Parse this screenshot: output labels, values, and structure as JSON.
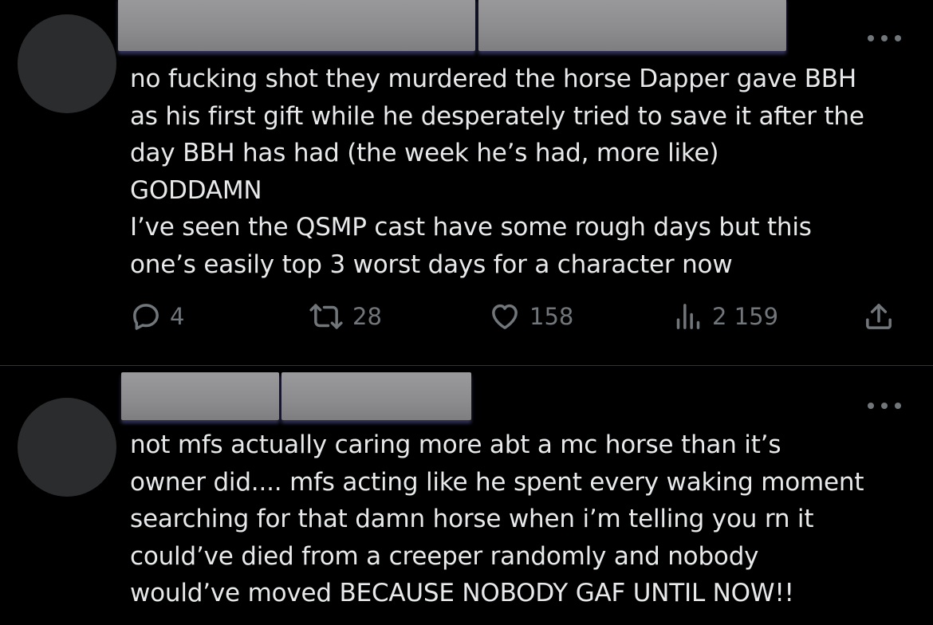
{
  "colors": {
    "background": "#000000",
    "text": "#e7e9ea",
    "muted": "#71767b",
    "divider": "#2f3336",
    "redaction": "#8c8c8e"
  },
  "tweets": [
    {
      "body_lines": [
        "no fucking shot they murdered the horse Dapper gave BBH",
        "as his first gift while he desperately tried to save it after the",
        "day BBH has had (the week he’s had, more like)",
        "GODDAMN",
        "I’ve seen the QSMP cast have some rough days but this",
        "one’s easily top 3 worst days for a character now"
      ],
      "actions": {
        "replies": "4",
        "reposts": "28",
        "likes": "158",
        "views": "2 159"
      },
      "icons": [
        "reply-icon",
        "repost-icon",
        "like-icon",
        "views-icon",
        "share-icon",
        "more-icon"
      ]
    },
    {
      "body_lines": [
        "not mfs actually caring more abt a mc horse than it’s",
        "owner did.... mfs acting like he spent every waking moment",
        "searching for that damn horse when i’m telling you rn it",
        "could’ve died from a creeper randomly and nobody",
        "would’ve moved BECAUSE NOBODY GAF UNTIL NOW!!"
      ],
      "icons": [
        "more-icon"
      ]
    }
  ]
}
